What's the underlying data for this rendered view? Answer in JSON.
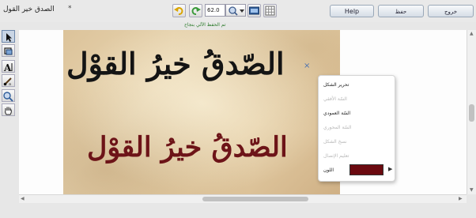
{
  "window": {
    "title": "الصدق خير القول",
    "modified_marker": "*"
  },
  "toolbar": {
    "exit_label": "خروج",
    "save_label": "حفظ",
    "help_label": "Help",
    "zoom_value": "62.0",
    "undo_icon": "undo-arrow-icon",
    "redo_icon": "redo-arrow-icon",
    "zoom_icon": "magnifier-icon",
    "fit_icon": "fit-to-window-icon",
    "grid_icon": "grid-icon"
  },
  "status": {
    "message": "تم الحفظ الآلي بنجاح",
    "color": "#2a7a2a"
  },
  "left_tools": [
    {
      "name": "select",
      "icon": "arrow-pointer-icon"
    },
    {
      "name": "crop",
      "icon": "crop-icon"
    },
    {
      "name": "text",
      "icon": "text-icon"
    },
    {
      "name": "brush",
      "icon": "brush-icon"
    },
    {
      "name": "zoom",
      "icon": "magnifier-icon"
    },
    {
      "name": "hand",
      "icon": "hand-icon"
    }
  ],
  "canvas": {
    "line1": "الصّدقُ خيرُ القوْل",
    "line2": "الصّدقُ خيرُ القوْل",
    "line1_color": "#141414",
    "line2_color": "#6d1418",
    "close_mark": "×"
  },
  "context_menu": {
    "items": [
      {
        "label": "تحرير الشكل",
        "enabled": true
      },
      {
        "label": "السّة الأفقي",
        "enabled": false
      },
      {
        "label": "السّة العمودي",
        "enabled": true
      },
      {
        "label": "السّة المحوري",
        "enabled": false
      },
      {
        "label": "نسخ الشكل",
        "enabled": false
      },
      {
        "label": "تعليم الإتصال",
        "enabled": false
      }
    ],
    "color_label": "اللون",
    "color_value": "#6b0a10"
  }
}
